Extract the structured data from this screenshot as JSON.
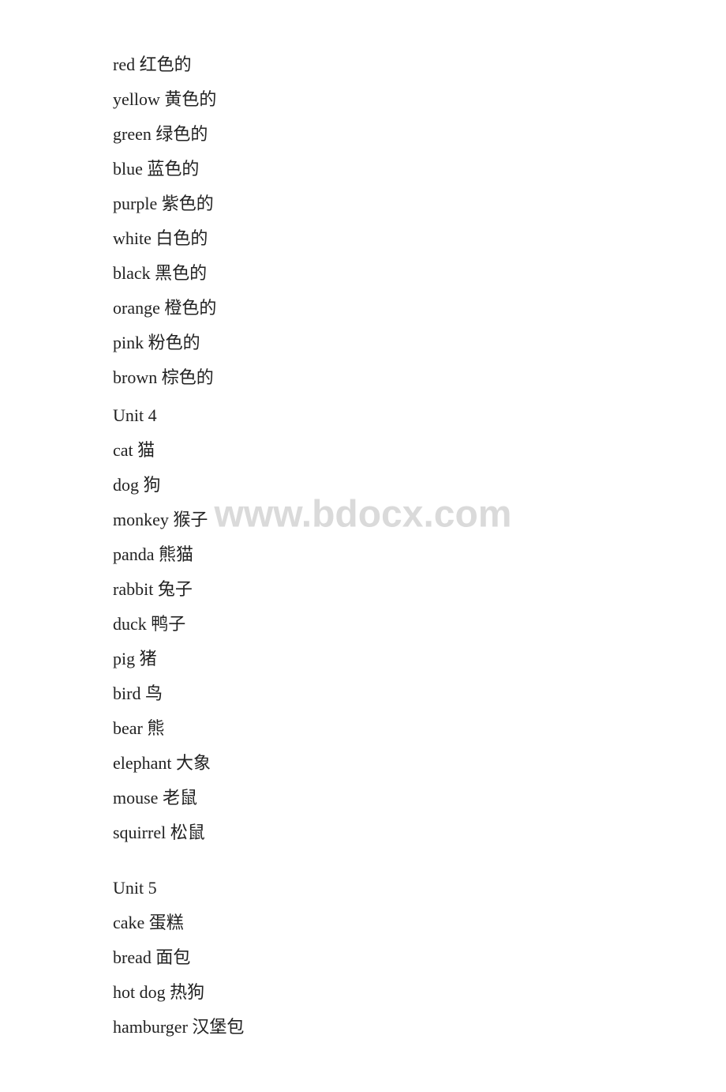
{
  "watermark": "www.bdocx.com",
  "sections": [
    {
      "type": "items",
      "items": [
        {
          "english": "red",
          "chinese": "红色的"
        },
        {
          "english": "yellow",
          "chinese": "黄色的"
        },
        {
          "english": "green",
          "chinese": "绿色的"
        },
        {
          "english": "blue",
          "chinese": "蓝色的"
        },
        {
          "english": "purple",
          "chinese": "紫色的"
        },
        {
          "english": "white",
          "chinese": "白色的"
        },
        {
          "english": "black",
          "chinese": "黑色的"
        },
        {
          "english": "orange",
          "chinese": "橙色的"
        },
        {
          "english": "pink",
          "chinese": "粉色的"
        },
        {
          "english": "brown",
          "chinese": "棕色的"
        }
      ]
    },
    {
      "type": "unit",
      "label": "Unit 4"
    },
    {
      "type": "items",
      "items": [
        {
          "english": "cat",
          "chinese": "猫"
        },
        {
          "english": "dog",
          "chinese": "狗"
        },
        {
          "english": "monkey",
          "chinese": "猴子"
        },
        {
          "english": "panda",
          "chinese": "熊猫"
        },
        {
          "english": "rabbit",
          "chinese": "兔子"
        },
        {
          "english": "duck",
          "chinese": "鸭子"
        },
        {
          "english": "pig",
          "chinese": "猪"
        },
        {
          "english": "bird",
          "chinese": "鸟"
        },
        {
          "english": "bear",
          "chinese": "熊"
        },
        {
          "english": "elephant",
          "chinese": "大象"
        },
        {
          "english": "mouse",
          "chinese": "老鼠"
        },
        {
          "english": "squirrel",
          "chinese": "松鼠"
        }
      ]
    },
    {
      "type": "spacer"
    },
    {
      "type": "unit",
      "label": "Unit 5"
    },
    {
      "type": "items",
      "items": [
        {
          "english": "cake",
          "chinese": "蛋糕"
        },
        {
          "english": "bread",
          "chinese": "面包"
        },
        {
          "english": "hot dog",
          "chinese": "热狗"
        },
        {
          "english": "hamburger",
          "chinese": "汉堡包"
        }
      ]
    }
  ]
}
